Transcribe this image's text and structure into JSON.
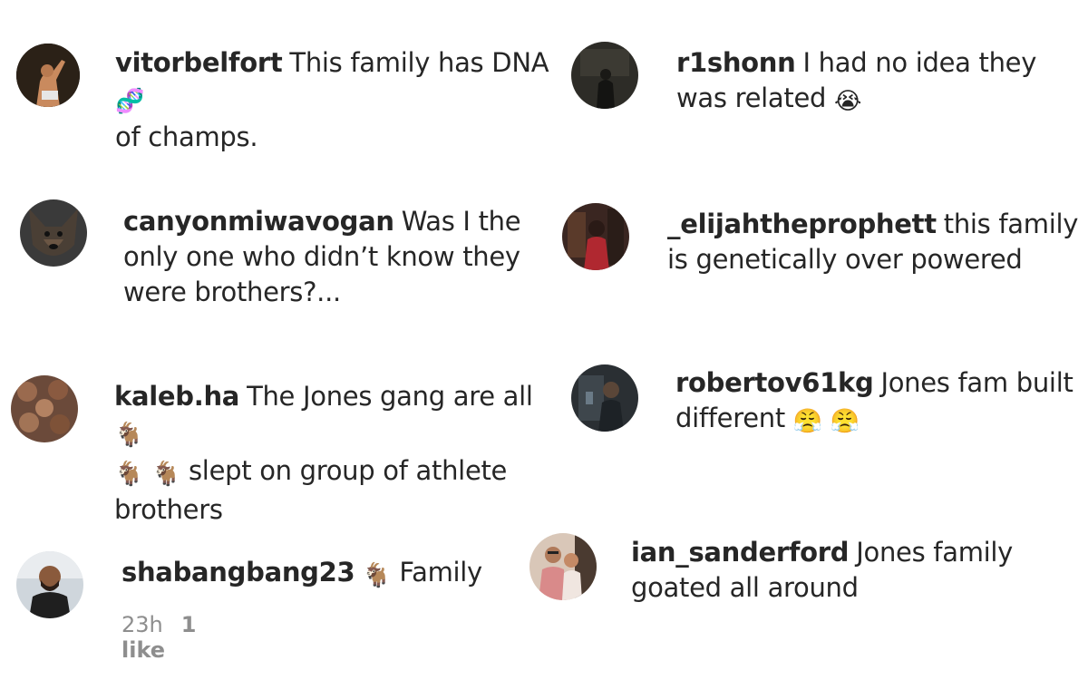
{
  "comments": [
    {
      "username": "vitorbelfort",
      "text": "This family has DNA",
      "emoji": "🧬",
      "text2": "of champs.",
      "avatar": "avatar-fighter-icon"
    },
    {
      "username": "r1shonn",
      "text": "I had no idea they was related",
      "emoji": "😭",
      "avatar": "avatar-dark-room-icon"
    },
    {
      "username": "canyonmiwavogan",
      "text": "Was I the only one who didn’t know they were brothers?...",
      "avatar": "avatar-dog-icon"
    },
    {
      "username": "_elijahtheprophett",
      "text": "this family is genetically over powered",
      "avatar": "avatar-person-red-icon"
    },
    {
      "username": "kaleb.ha",
      "text": "The Jones gang are all",
      "emoji": "🐐",
      "emoji2": "🐐",
      "emoji3": "🐐",
      "text2": "slept on group of athlete brothers",
      "avatar": "avatar-collage-icon"
    },
    {
      "username": "robertov61kg",
      "text": "Jones fam built different",
      "emoji": "😤",
      "emoji2": "😤",
      "avatar": "avatar-mirror-selfie-icon"
    },
    {
      "username": "shabangbang23",
      "emoji": "🐐",
      "text": "Family",
      "time": "23h",
      "likes": "1 like",
      "avatar": "avatar-bearded-man-icon"
    },
    {
      "username": "ian_sanderford",
      "text": "Jones family goated all around",
      "avatar": "avatar-couple-icon"
    }
  ]
}
